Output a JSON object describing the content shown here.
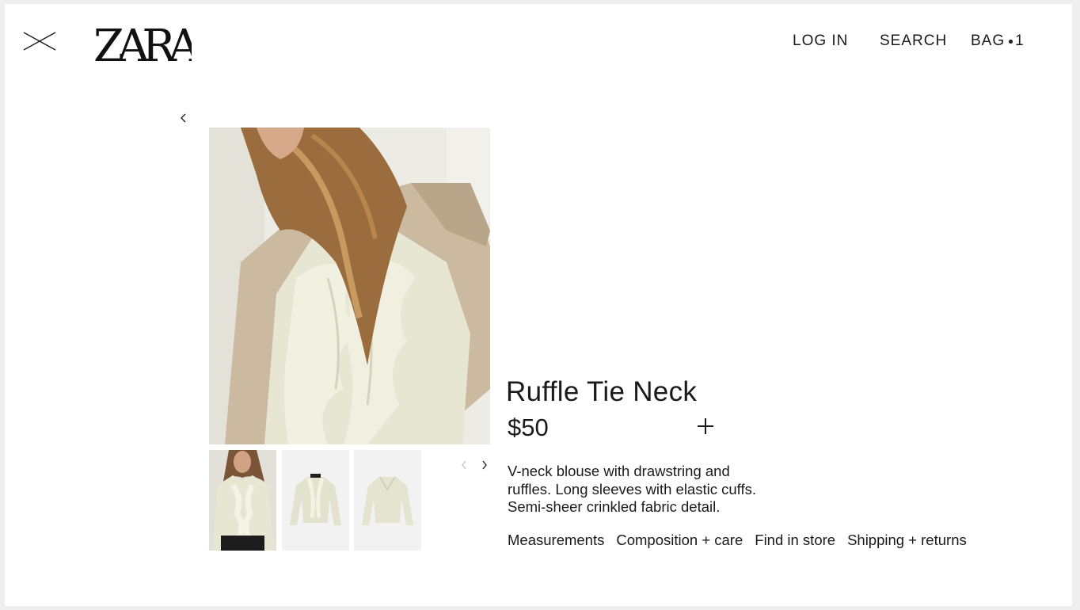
{
  "header": {
    "logo_text": "ZARA",
    "nav": {
      "login": "LOG IN",
      "search": "SEARCH",
      "bag_label": "BAG",
      "bag_count": "1"
    }
  },
  "icons": {
    "close": "close-icon",
    "back": "chevron-left-icon",
    "thumb_prev": "chevron-left-icon",
    "thumb_next": "chevron-right-icon",
    "add": "plus-icon"
  },
  "product": {
    "title": "Ruffle Tie Neck",
    "price": "$50",
    "description": [
      "V-neck blouse with drawstring and",
      "ruffles. Long sleeves with elastic cuffs.",
      "Semi-sheer crinkled fabric detail."
    ],
    "links": [
      "Measurements",
      "Composition + care",
      "Find in store",
      "Shipping + returns"
    ]
  },
  "colors": {
    "text": "#1a1a1a",
    "garment": "#e6e6d3",
    "thumb_bg": "#f2f2f2"
  }
}
